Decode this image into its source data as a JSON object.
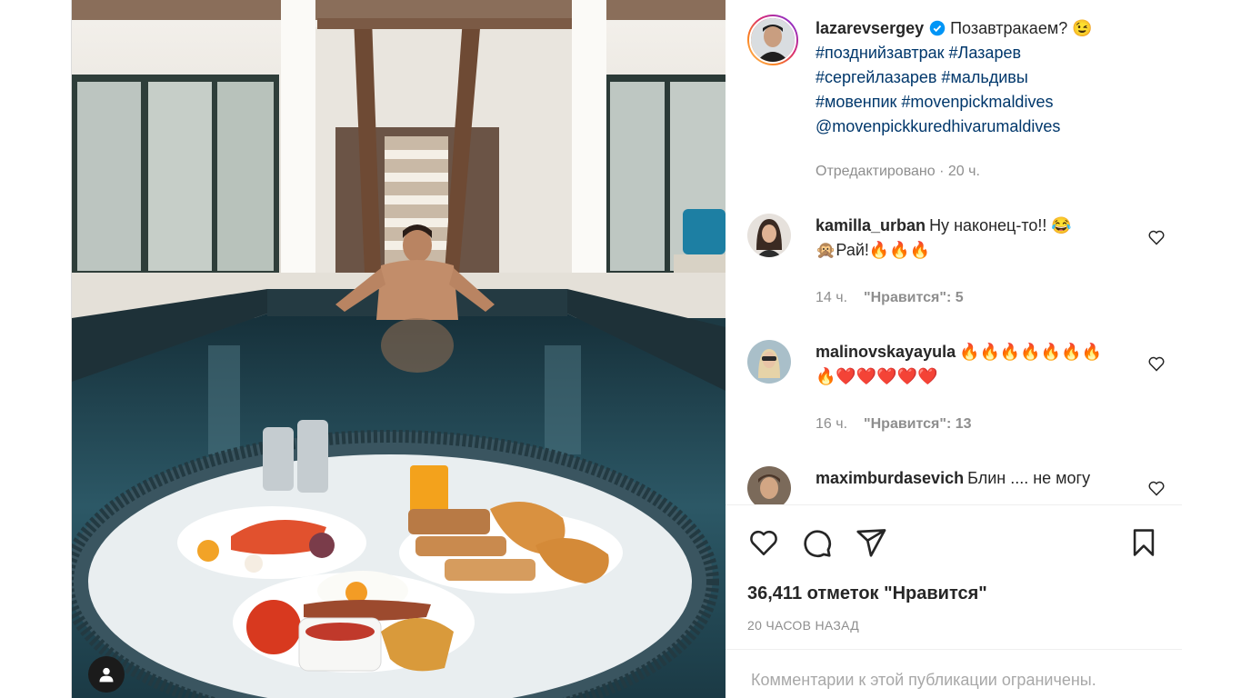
{
  "post": {
    "author": {
      "username": "lazarevsergey",
      "verified_icon": "verified-badge-icon",
      "caption_lines": [
        "Позавтракаем? 😉",
        "#позднийзавтрак #Лазарев",
        "#сергейлазарев #мальдивы",
        "#мовенпик #movenpickmaldives",
        "@movenpickkuredhivarumaldives"
      ],
      "edited_label": "Отредактировано · 20 ч."
    },
    "comments": [
      {
        "username": "kamilla_urban",
        "lines": [
          "Ну наконец-то!! 😂",
          "🙊Рай!🔥🔥🔥"
        ],
        "time": "14 ч.",
        "likes": "\"Нравится\": 5"
      },
      {
        "username": "malinovskayayula",
        "lines": [
          "🔥🔥🔥🔥🔥🔥🔥",
          "🔥❤️❤️❤️❤️❤️"
        ],
        "time": "16 ч.",
        "likes": "\"Нравится\": 13"
      },
      {
        "username": "maximburdasevich",
        "lines": [
          "Блин .... не могу"
        ],
        "time": "",
        "likes": ""
      }
    ],
    "actions": {
      "like_icon": "heart-icon",
      "comment_icon": "comment-bubble-icon",
      "share_icon": "paper-plane-icon",
      "save_icon": "bookmark-icon"
    },
    "likes_count": "36,411 отметок \"Нравится\"",
    "time_ago": "20 ЧАСОВ НАЗАД",
    "comments_restricted": "Комментарии к этой публикации ограничены."
  },
  "colors": {
    "link": "#00376b",
    "muted": "#8e8e8e",
    "verified": "#0095f6",
    "heart_red": "#e0245e"
  }
}
